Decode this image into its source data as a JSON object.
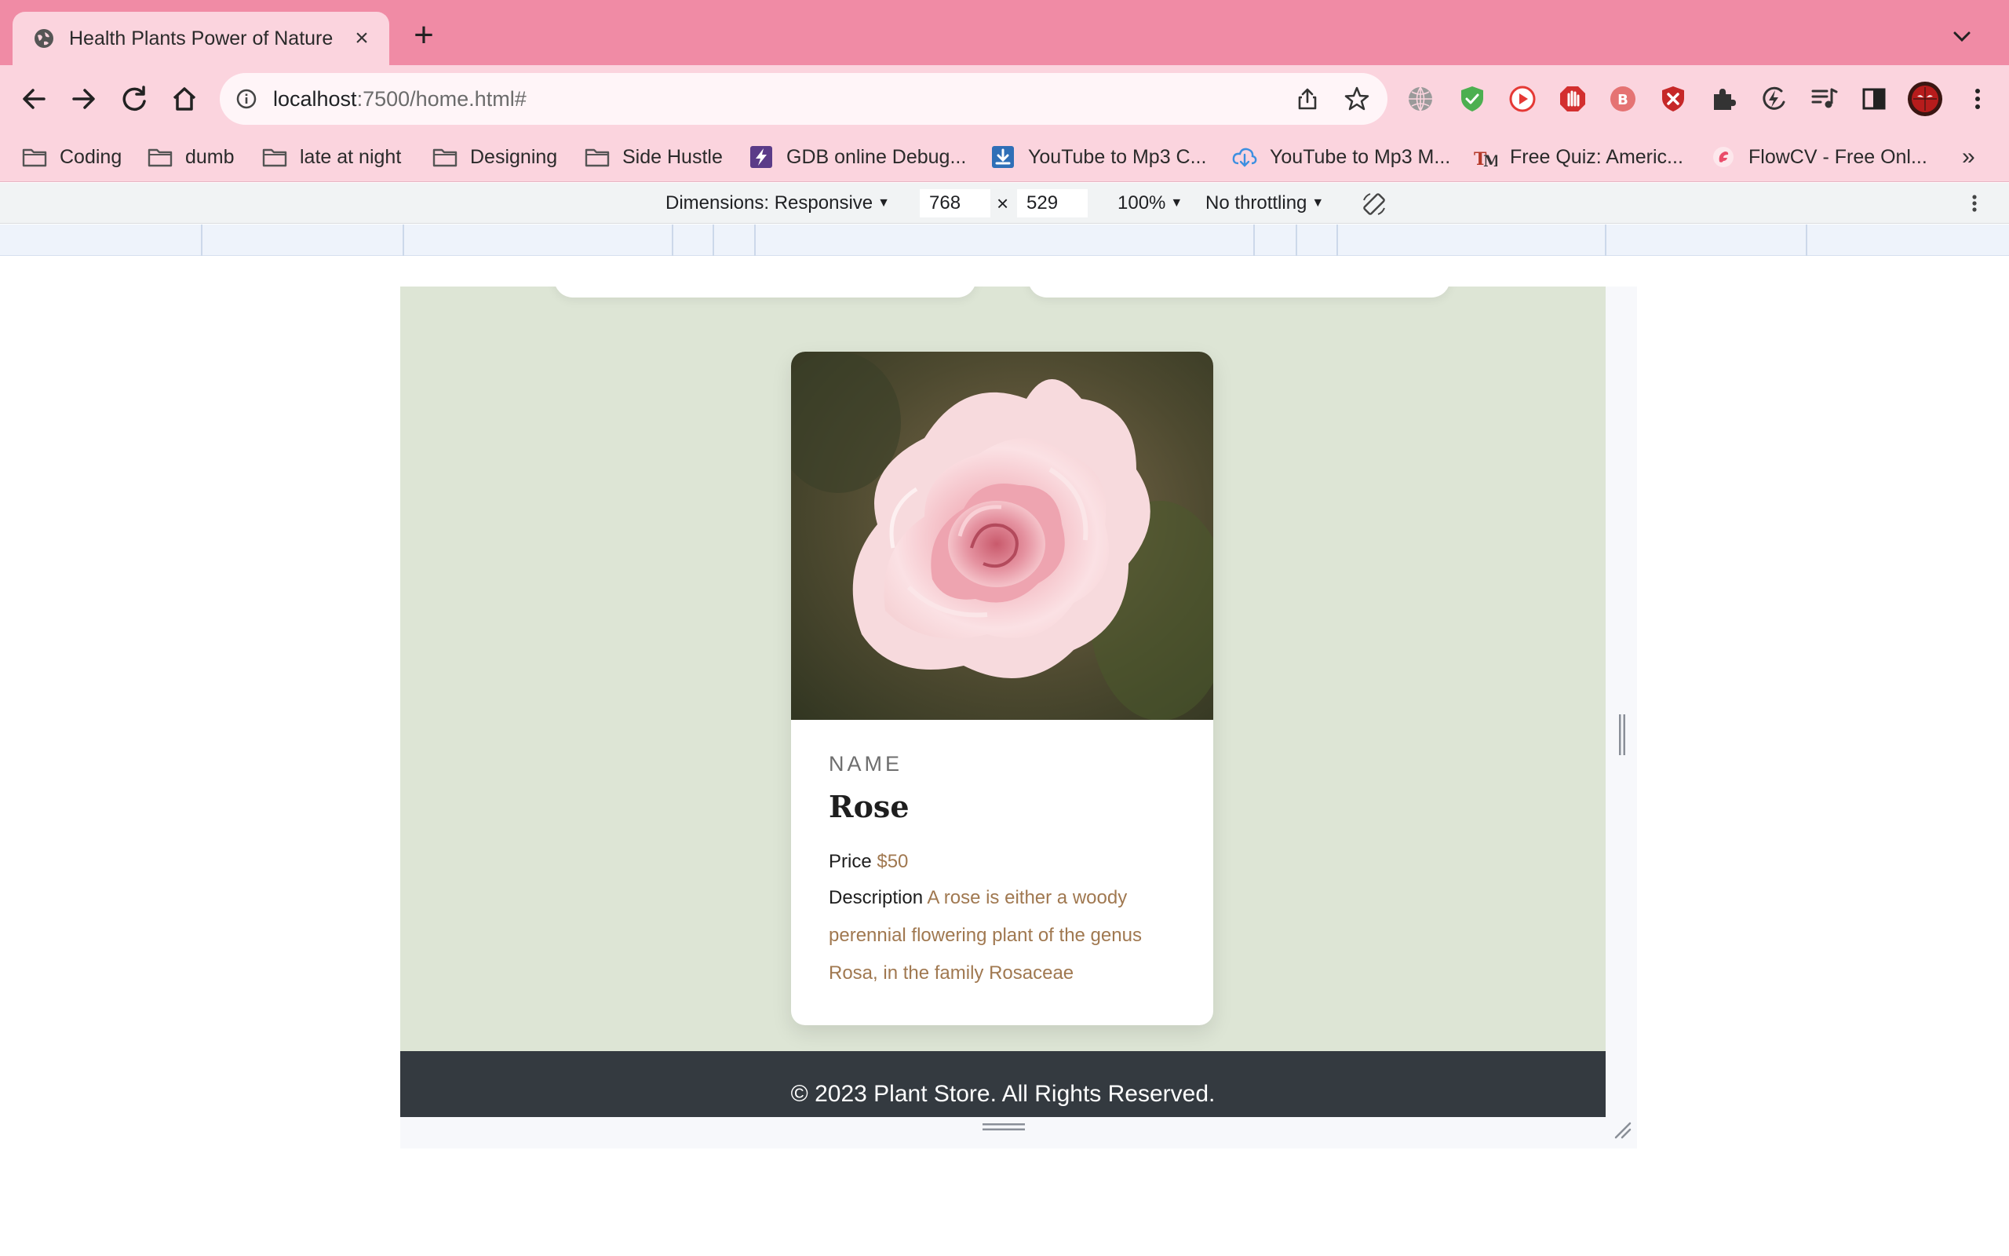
{
  "browser": {
    "tab": {
      "title": "Health Plants Power of Nature",
      "close": "×"
    },
    "new_tab": "+",
    "omnibox": {
      "host": "localhost",
      "path": ":7500/home.html#"
    },
    "bookmarks": [
      {
        "label": "Coding",
        "icon": "folder-icon"
      },
      {
        "label": "dumb",
        "icon": "folder-icon"
      },
      {
        "label": "late at night",
        "icon": "folder-icon"
      },
      {
        "label": "Designing",
        "icon": "folder-icon"
      },
      {
        "label": "Side Hustle",
        "icon": "folder-icon"
      },
      {
        "label": "GDB online Debug...",
        "icon": "gdb-bolt-icon"
      },
      {
        "label": "YouTube to Mp3 C...",
        "icon": "download-icon"
      },
      {
        "label": "YouTube to Mp3 M...",
        "icon": "cloud-download-icon"
      },
      {
        "label": "Free Quiz: Americ...",
        "icon": "quiz-logo-icon"
      },
      {
        "label": "FlowCV - Free Onl...",
        "icon": "flowcv-logo-icon"
      }
    ],
    "bookmarks_more": "»",
    "extensions": [
      "globe-icon",
      "shield-check-icon",
      "youtube-circle-icon",
      "stop-hand-icon",
      "b-badge-icon",
      "ublock-shield-icon",
      "puzzle-icon",
      "bolt-circle-icon",
      "media-queue-icon",
      "side-panel-icon",
      "profile-avatar-icon",
      "kebab-menu-icon"
    ]
  },
  "devtools": {
    "dimensions_label": "Dimensions: Responsive",
    "width": "768",
    "height": "529",
    "times": "×",
    "zoom": "100%",
    "throttling": "No throttling"
  },
  "page": {
    "card": {
      "name_label": "NAME",
      "plant_name": "Rose",
      "price_label": "Price",
      "price_value": "$50",
      "description_label": "Description",
      "description_value": "A rose is either a woody perennial flowering plant of the genus Rosa, in the family Rosaceae"
    },
    "footer": {
      "copyright": "© 2023 Plant Store. All Rights Reserved."
    }
  },
  "colors": {
    "tab_strip": "#f08ba5",
    "toolbar": "#fbd4de",
    "page_background": "#dde5d5",
    "accent_text": "#a07850",
    "footer_background": "#343a40"
  }
}
